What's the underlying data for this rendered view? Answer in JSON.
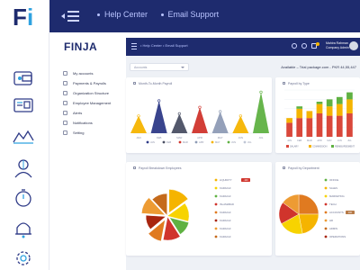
{
  "outer": {
    "logo": {
      "letter_f": "F",
      "letter_i": "i"
    },
    "nav": [
      {
        "label": "Help Center"
      },
      {
        "label": "Email Support"
      }
    ]
  },
  "inner": {
    "brand": "FINJA",
    "breadcrumb": "• Help Center  • Email Support",
    "user": {
      "name": "Mahira Rahman",
      "role": "Company Admin"
    },
    "menu": [
      "My accounts",
      "Payments & Payrolls",
      "Organization Structure",
      "Employee Management",
      "Alerts",
      "Notifications",
      "Setting"
    ],
    "select": {
      "value": "Accounts"
    },
    "trial_text": "Available – Trial package.com - PKR 44,55,447"
  },
  "cards": {
    "month_payroll": {
      "title": "Month-To-Month Payroll"
    },
    "payroll_type": {
      "title": "Payroll by Type"
    },
    "payroll_breakdown": {
      "title": "Payroll Breakdown Employees"
    },
    "payroll_department": {
      "title": "Payroll by Department"
    }
  },
  "chart_data": [
    {
      "type": "area",
      "title": "Month-To-Month Payroll",
      "categories": [
        "JAN",
        "FEB",
        "MAR",
        "APR",
        "MAY",
        "JUN",
        "JUL"
      ],
      "series": [
        {
          "values": [
            40,
            75,
            45,
            60,
            50,
            40,
            95
          ],
          "colors": [
            "#f5b400",
            "#2e3a87",
            "#4a4f63",
            "#d0342c",
            "#8e9bb5",
            "#f5b400",
            "#5fb142"
          ]
        }
      ],
      "legend_colors": [
        "#2e3a87",
        "#4a4f63",
        "#d0342c",
        "#8e9bb5",
        "#f5b400",
        "#5fb142",
        "#c0c6d6"
      ]
    },
    {
      "type": "bar",
      "title": "Payroll by Type",
      "categories": [
        "JAN",
        "FEB",
        "MAR",
        "APR",
        "MAY",
        "JUN",
        "JUL"
      ],
      "ylim": [
        0,
        100
      ],
      "series": [
        {
          "color": "#d9473a",
          "values": [
            30,
            40,
            40,
            50,
            45,
            45,
            50
          ]
        },
        {
          "color": "#f5b400",
          "values": [
            10,
            20,
            15,
            20,
            20,
            25,
            30
          ]
        },
        {
          "color": "#5fb142",
          "values": [
            0,
            5,
            0,
            5,
            15,
            15,
            15
          ]
        }
      ],
      "legend": [
        {
          "label": "SALARY",
          "color": "#d9473a"
        },
        {
          "label": "COMMISSION",
          "color": "#f5b400"
        },
        {
          "label": "REIMBURSEMENT",
          "color": "#5fb142"
        }
      ]
    },
    {
      "type": "pie",
      "title": "Payroll Breakdown Employees",
      "slices": [
        {
          "label": "LIQUIDITY",
          "value": 15,
          "color": "#f5b400"
        },
        {
          "label": "KARACHI",
          "value": 14,
          "color": "#f7d300"
        },
        {
          "label": "KARACHI",
          "value": 12,
          "color": "#5fb142"
        },
        {
          "label": "ISLAMABAD",
          "value": 12,
          "color": "#d0342c"
        },
        {
          "label": "KARACHI",
          "value": 11,
          "color": "#e07a20"
        },
        {
          "label": "KARACHI",
          "value": 12,
          "color": "#a8250f"
        },
        {
          "label": "KARACHI",
          "value": 12,
          "color": "#ed9b33"
        },
        {
          "label": "KARACHI",
          "value": 12,
          "color": "#c56a1b"
        }
      ],
      "pill": "-100"
    },
    {
      "type": "pie",
      "title": "Payroll by Department",
      "slices": [
        {
          "label": "OFFICE",
          "value": 25,
          "color": "#e07a20"
        },
        {
          "label": "SALES",
          "value": 22,
          "color": "#f5b400"
        },
        {
          "label": "MARKETING",
          "value": 20,
          "color": "#f7d300"
        },
        {
          "label": "TECH",
          "value": 18,
          "color": "#d0342c"
        },
        {
          "label": "HR",
          "value": 15,
          "color": "#ed9b33"
        }
      ],
      "legend": [
        "OFFICE",
        "SALES",
        "MARKETING",
        "TECH",
        "ACCOUNTS",
        "HR",
        "ADMIN",
        "OPERATIONS"
      ],
      "pill": "100"
    }
  ]
}
